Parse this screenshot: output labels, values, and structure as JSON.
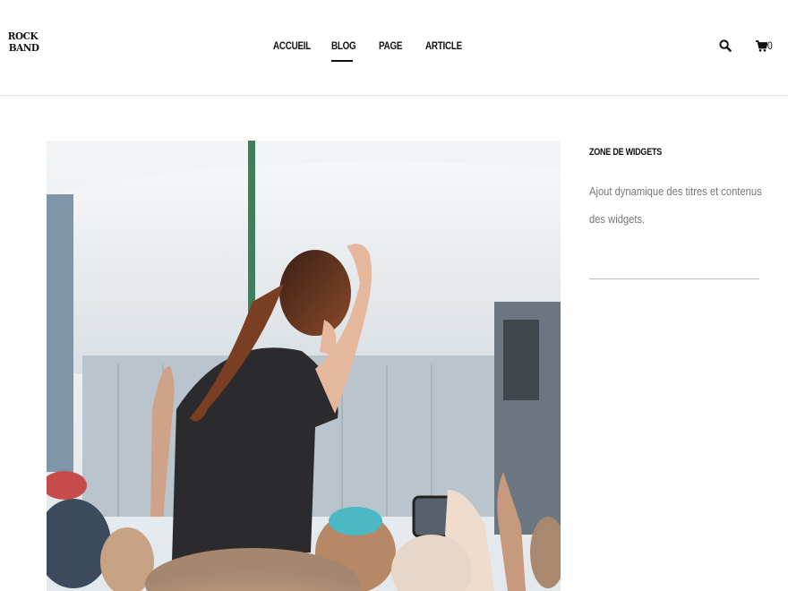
{
  "logo": {
    "line1": "ROCK",
    "line2": "BAND"
  },
  "nav": {
    "items": [
      {
        "label": "ACCUEIL"
      },
      {
        "label": "BLOG"
      },
      {
        "label": "PAGE"
      },
      {
        "label": "ARTICLE"
      }
    ],
    "active": "BLOG"
  },
  "header_icons": {
    "search": "search-icon",
    "cart": "cart-icon",
    "cart_count": "0"
  },
  "hero": {
    "image": "crowd-concert-photo"
  },
  "sidebar": {
    "widget_title": "ZONE DE WIDGETS",
    "widget_text": "Ajout dynamique des titres et contenus des widgets."
  },
  "colors": {
    "text": "#111111",
    "muted": "#777777",
    "divider": "#bdbdbd"
  }
}
